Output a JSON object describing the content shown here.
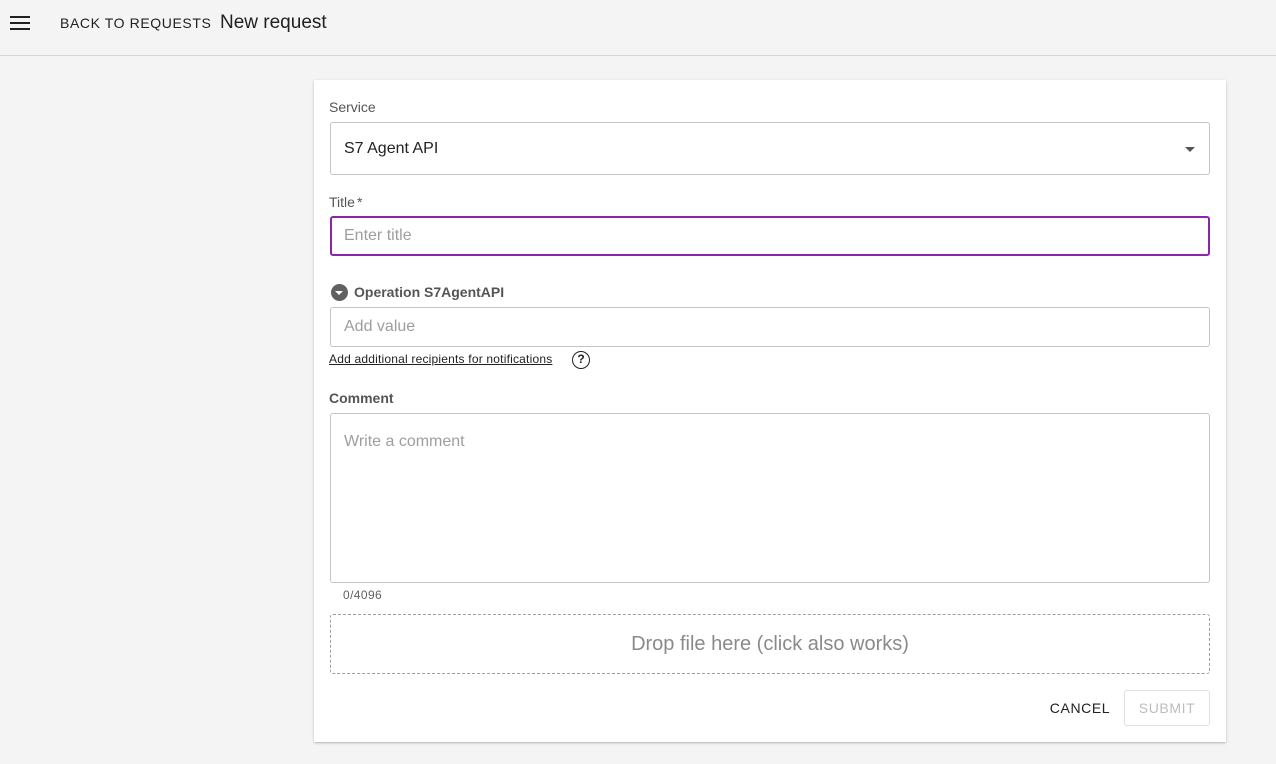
{
  "header": {
    "menu_icon": "hamburger-menu-icon",
    "back_label": "BACK TO REQUESTS",
    "title": "New request"
  },
  "form": {
    "service": {
      "label": "Service",
      "value": "S7 Agent API",
      "icon": "caret-down-icon"
    },
    "title_field": {
      "label": "Title",
      "required_mark": "*",
      "placeholder": "Enter title",
      "value": ""
    },
    "operation": {
      "icon": "collapse-toggle-icon",
      "label": "Operation S7AgentAPI",
      "placeholder": "Add value"
    },
    "recipients_link": "Add additional recipients for notifications",
    "help_icon_glyph": "?",
    "comment": {
      "label": "Comment",
      "placeholder": "Write a comment",
      "counter": "0/4096"
    },
    "dropzone_label": "Drop file here (click also works)",
    "cancel_label": "CANCEL",
    "submit_label": "SUBMIT"
  },
  "colors": {
    "focus_border": "#8e24aa",
    "background": "#f4f4f4",
    "card": "#ffffff"
  }
}
